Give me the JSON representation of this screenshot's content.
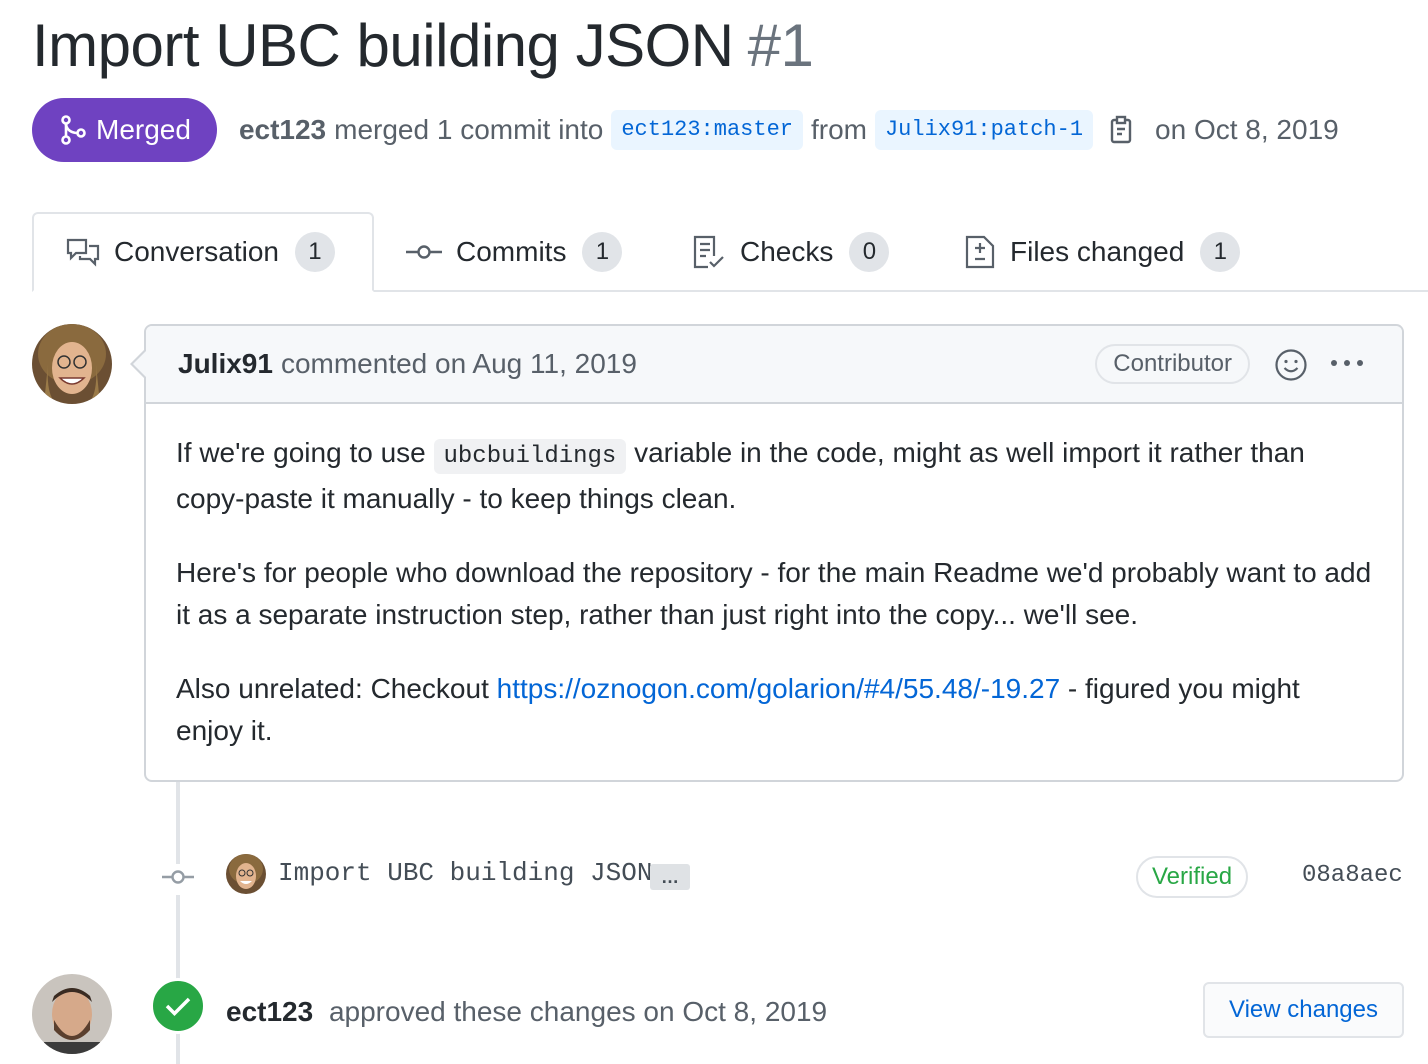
{
  "pr": {
    "title": "Import UBC building JSON",
    "number": "#1",
    "state": "Merged",
    "merger": "ect123",
    "merge_text": "merged 1 commit into",
    "base_branch": "ect123:master",
    "from_text": "from",
    "head_branch": "Julix91:patch-1",
    "merged_date_text": "on Oct 8, 2019"
  },
  "tabs": [
    {
      "label": "Conversation",
      "count": "1",
      "icon": "comment-discussion-icon",
      "selected": true
    },
    {
      "label": "Commits",
      "count": "1",
      "icon": "git-commit-icon"
    },
    {
      "label": "Checks",
      "count": "0",
      "icon": "checklist-icon"
    },
    {
      "label": "Files changed",
      "count": "1",
      "icon": "file-diff-icon"
    }
  ],
  "comment": {
    "author": "Julix91",
    "action": "commented on Aug 11, 2019",
    "role": "Contributor",
    "para1_before": "If we're going to use",
    "para1_code": "ubcbuildings",
    "para1_after": "variable in the code, might as well import it rather than copy-paste it manually - to keep things clean.",
    "para2": "Here's for people who download the repository - for the main Readme we'd probably want to add it as a separate instruction step, rather than just right into the copy... we'll see.",
    "para3_before": "Also unrelated: Checkout",
    "para3_link": "https://oznogon.com/golarion/#4/55.48/-19.27",
    "para3_after": "- figured you might enjoy it."
  },
  "commit": {
    "message": "Import UBC building JSON",
    "ellipsis": "…",
    "verified": "Verified",
    "sha": "08a8aec"
  },
  "review": {
    "author": "ect123",
    "text": "approved these changes on Oct 8, 2019",
    "button": "View changes"
  },
  "colors": {
    "merged": "#6f42c1",
    "approved": "#28a745",
    "link": "#0366d6",
    "branch_bg": "#eaf5ff"
  }
}
